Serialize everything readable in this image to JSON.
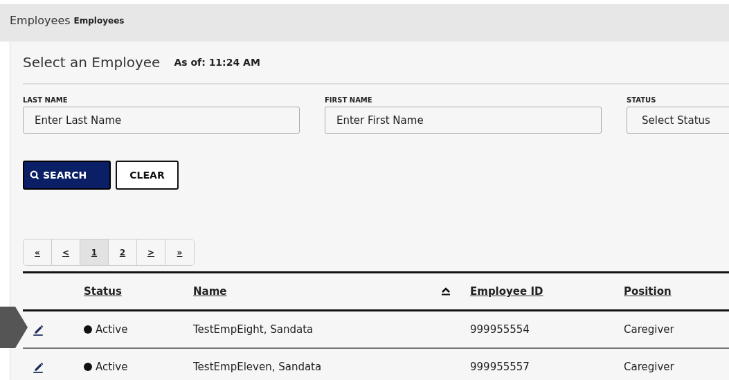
{
  "header": {
    "title": "Employees",
    "subtitle": "Employees"
  },
  "panel": {
    "title": "Select an Employee",
    "as_of": "As of: 11:24 AM"
  },
  "filters": [
    {
      "label": "LAST NAME",
      "placeholder": "Enter Last Name",
      "kind": "text"
    },
    {
      "label": "FIRST NAME",
      "placeholder": "Enter First Name",
      "kind": "text"
    },
    {
      "label": "STATUS",
      "value": "Select Status",
      "kind": "select"
    }
  ],
  "buttons": [
    {
      "label": "SEARCH",
      "kind": "primary"
    },
    {
      "label": "CLEAR",
      "kind": "secondary"
    }
  ],
  "pagination": [
    {
      "label": "«",
      "selected": false
    },
    {
      "label": "<",
      "selected": false
    },
    {
      "label": "1",
      "selected": true
    },
    {
      "label": "2",
      "selected": false
    },
    {
      "label": ">",
      "selected": false
    },
    {
      "label": "»",
      "selected": false
    }
  ],
  "table": {
    "columns": [
      {
        "label": "Status",
        "sorted": false
      },
      {
        "label": "Name",
        "sorted": true
      },
      {
        "label": "Employee ID",
        "sorted": false
      },
      {
        "label": "Position",
        "sorted": false
      }
    ],
    "rows": [
      {
        "status": "Active",
        "name": "TestEmpEight, Sandata",
        "employee_id": "999955554",
        "position": "Caregiver"
      },
      {
        "status": "Active",
        "name": "TestEmpEleven, Sandata",
        "employee_id": "999955557",
        "position": "Caregiver"
      }
    ]
  }
}
